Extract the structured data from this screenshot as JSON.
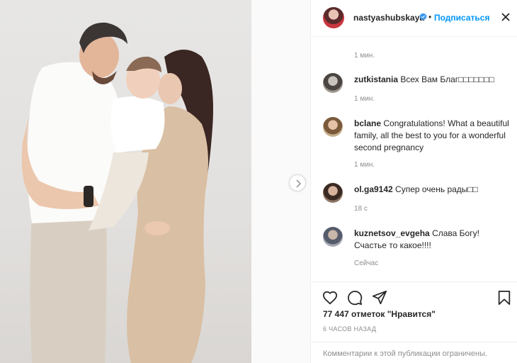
{
  "post": {
    "author": "nastyashubskaya",
    "follow_label": "Подписаться",
    "separator": "•",
    "top_time": "1 мин.",
    "likes_label": "77 447 отметок \"Нравится\"",
    "posted_ago": "6 ЧАСОВ НАЗАД",
    "comments_restricted": "Комментарии к этой публикации ограничены."
  },
  "comments": [
    {
      "user": "zutkistania",
      "text": "Всех Вам Благ□□□□□□□",
      "time": "1 мин."
    },
    {
      "user": "bclane",
      "text": "Congratulations! What a beautiful family, all the best to you for a wonderful second pregnancy",
      "time": "1 мин."
    },
    {
      "user": "ol.ga9142",
      "text": "Супер очень рады□□",
      "time": "18 с"
    },
    {
      "user": "kuznetsov_evgeha",
      "text": "Слава Богу! Счастье то какое!!!!",
      "time": "Сейчас"
    }
  ],
  "icons": {
    "more": "more-horizontal-icon",
    "verified": "verified-badge-icon",
    "like": "heart-outline-icon",
    "comment": "comment-bubble-icon",
    "share": "paper-plane-icon",
    "save": "bookmark-icon",
    "next": "chevron-right-icon"
  },
  "colors": {
    "accent": "#0095f6",
    "text": "#262626",
    "muted": "#8e8e8e",
    "border": "#efefef"
  }
}
